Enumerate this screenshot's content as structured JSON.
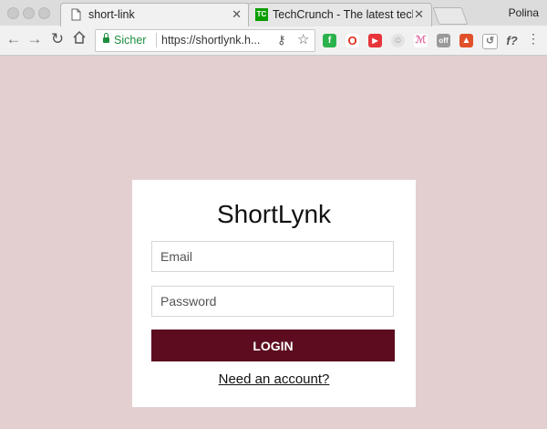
{
  "browser": {
    "tabs": [
      {
        "title": "short-link",
        "active": true
      },
      {
        "title": "TechCrunch - The latest techn",
        "active": false
      }
    ],
    "profile_name": "Polina",
    "security_label": "Sicher",
    "url": "https://shortlynk.h..."
  },
  "extensions": [
    {
      "name": "feedly-icon",
      "color": "#2bb24c"
    },
    {
      "name": "opera-icon",
      "color": "#e0301e"
    },
    {
      "name": "video-icon",
      "color": "#e8353a"
    },
    {
      "name": "emoji-icon",
      "color": "#d9d9d9"
    },
    {
      "name": "badge-icon",
      "color": "#e06ea6"
    },
    {
      "name": "off-icon",
      "color": "#999999"
    },
    {
      "name": "fire-icon",
      "color": "#e0512a"
    },
    {
      "name": "recycle-icon",
      "color": "#9a9a9a"
    },
    {
      "name": "function-icon",
      "color": "#555555"
    }
  ],
  "login": {
    "brand": "ShortLynk",
    "email_placeholder": "Email",
    "password_placeholder": "Password",
    "login_label": "LOGIN",
    "signup_link": "Need an account?"
  },
  "colors": {
    "background": "#e3cfd0",
    "button": "#5c0c1e"
  }
}
